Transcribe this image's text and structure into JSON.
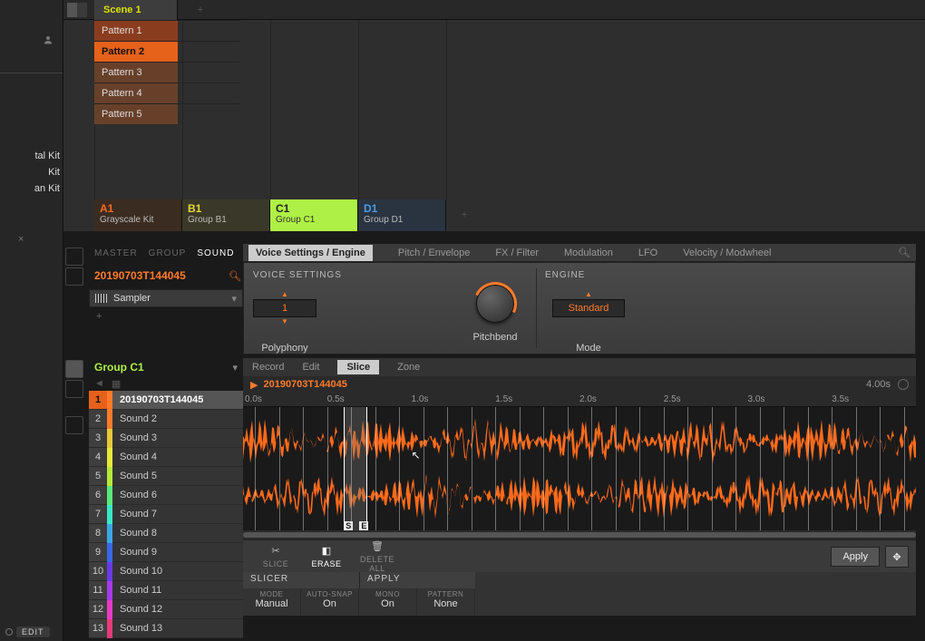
{
  "scenes": {
    "active": "Scene 1"
  },
  "patterns": [
    "Pattern 1",
    "Pattern 2",
    "Pattern 3",
    "Pattern 4",
    "Pattern 5"
  ],
  "selected_pattern_index": 1,
  "kits": [
    "tal Kit",
    "Kit",
    "an Kit"
  ],
  "edit_badge": "EDIT",
  "groups": [
    {
      "id": "A1",
      "name": "Grayscale Kit",
      "color": "c-orange"
    },
    {
      "id": "B1",
      "name": "Group B1",
      "color": "c-yellow"
    },
    {
      "id": "C1",
      "name": "Group C1",
      "color": "c-green"
    },
    {
      "id": "D1",
      "name": "Group D1",
      "color": "c-blue"
    }
  ],
  "scope_tabs": [
    "MASTER",
    "GROUP",
    "SOUND"
  ],
  "active_scope": "SOUND",
  "sound_name": "20190703T144045",
  "plugin": "Sampler",
  "param_tabs": [
    "Voice Settings / Engine",
    "Pitch / Envelope",
    "FX / Filter",
    "Modulation",
    "LFO",
    "Velocity / Modwheel"
  ],
  "active_param_tab": 0,
  "voice_section_label": "VOICE SETTINGS",
  "engine_section_label": "ENGINE",
  "polyphony": {
    "value": "1",
    "label": "Polyphony"
  },
  "pitchbend": {
    "label": "Pitchbend"
  },
  "engine_mode": {
    "value": "Standard",
    "label": "Mode"
  },
  "group_header": "Group C1",
  "sound_list": [
    {
      "n": "1",
      "name": "20190703T144045",
      "color": "#ff7a2a",
      "sel": true
    },
    {
      "n": "2",
      "name": "Sound 2",
      "color": "#ff7a2a"
    },
    {
      "n": "3",
      "name": "Sound 3",
      "color": "#e8c83a"
    },
    {
      "n": "4",
      "name": "Sound 4",
      "color": "#e8e83a"
    },
    {
      "n": "5",
      "name": "Sound 5",
      "color": "#b8e83a"
    },
    {
      "n": "6",
      "name": "Sound 6",
      "color": "#5ae87a"
    },
    {
      "n": "7",
      "name": "Sound 7",
      "color": "#3ae8c8"
    },
    {
      "n": "8",
      "name": "Sound 8",
      "color": "#3aa8e8"
    },
    {
      "n": "9",
      "name": "Sound 9",
      "color": "#3a68e8"
    },
    {
      "n": "10",
      "name": "Sound 10",
      "color": "#6a3ae8"
    },
    {
      "n": "11",
      "name": "Sound 11",
      "color": "#a83ae8"
    },
    {
      "n": "12",
      "name": "Sound 12",
      "color": "#e83ac8"
    },
    {
      "n": "13",
      "name": "Sound 13",
      "color": "#e83a78"
    }
  ],
  "edit_tabs": [
    "Record",
    "Edit",
    "Slice",
    "Zone"
  ],
  "active_edit_tab": 2,
  "waveform_name": "20190703T144045",
  "duration": "4.00s",
  "time_ticks": [
    "0.0s",
    "0.5s",
    "1.0s",
    "1.5s",
    "2.0s",
    "2.5s",
    "3.0s",
    "3.5s"
  ],
  "slice_tools": [
    {
      "label": "SLICE",
      "active": false
    },
    {
      "label": "ERASE",
      "active": true
    },
    {
      "label": "DELETE ALL",
      "active": false
    }
  ],
  "apply_label": "Apply",
  "slicer_hdr": [
    "SLICER",
    "APPLY"
  ],
  "slicer_params": [
    {
      "hdr": "MODE",
      "val": "Manual"
    },
    {
      "hdr": "AUTO-SNAP",
      "val": "On"
    },
    {
      "hdr": "MONO",
      "val": "On"
    },
    {
      "hdr": "PATTERN",
      "val": "None"
    }
  ],
  "se_markers": {
    "s": "S",
    "e": "E"
  }
}
